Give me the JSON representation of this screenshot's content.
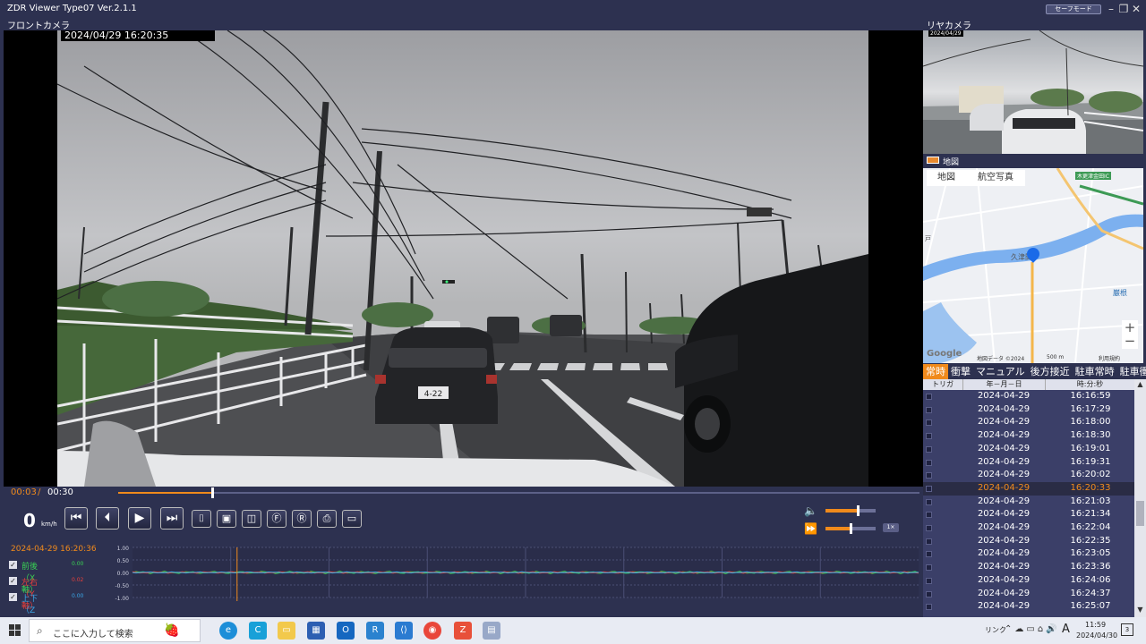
{
  "window": {
    "title": "ZDR Viewer Type07 Ver.2.1.1",
    "safe_mode_label": "セーフモード"
  },
  "front_camera": {
    "label": "フロントカメラ",
    "timestamp": "2024/04/29   16:20:35",
    "plate_text": "4-22"
  },
  "rear_camera": {
    "label": "リヤカメラ",
    "timestamp": "2024/04/29"
  },
  "map": {
    "title": "地図",
    "tabs": [
      "地図",
      "航空写真"
    ],
    "labels": {
      "area": "久津間",
      "ic": "木更津金田IC",
      "left": "戸",
      "right": "巌根",
      "google": "Google"
    },
    "credit": "地図データ ©2024",
    "scale": "500 m",
    "terms": "利用規約",
    "zoom_in": "+",
    "zoom_out": "−"
  },
  "record_tabs": [
    {
      "label": "常時",
      "active": true
    },
    {
      "label": "衝撃",
      "active": false
    },
    {
      "label": "マニュアル",
      "active": false
    },
    {
      "label": "後方接近",
      "active": false
    },
    {
      "label": "駐車常時",
      "active": false
    },
    {
      "label": "駐車衝撃",
      "active": false
    }
  ],
  "record_list": {
    "headers": {
      "trigger": "トリガ",
      "date": "年－月－日",
      "time": "時:分:秒"
    },
    "selected_index": 7,
    "rows": [
      {
        "date": "2024-04-29",
        "time": "16:16:59"
      },
      {
        "date": "2024-04-29",
        "time": "16:17:29"
      },
      {
        "date": "2024-04-29",
        "time": "16:18:00"
      },
      {
        "date": "2024-04-29",
        "time": "16:18:30"
      },
      {
        "date": "2024-04-29",
        "time": "16:19:01"
      },
      {
        "date": "2024-04-29",
        "time": "16:19:31"
      },
      {
        "date": "2024-04-29",
        "time": "16:20:02"
      },
      {
        "date": "2024-04-29",
        "time": "16:20:33"
      },
      {
        "date": "2024-04-29",
        "time": "16:21:03"
      },
      {
        "date": "2024-04-29",
        "time": "16:21:34"
      },
      {
        "date": "2024-04-29",
        "time": "16:22:04"
      },
      {
        "date": "2024-04-29",
        "time": "16:22:35"
      },
      {
        "date": "2024-04-29",
        "time": "16:23:05"
      },
      {
        "date": "2024-04-29",
        "time": "16:23:36"
      },
      {
        "date": "2024-04-29",
        "time": "16:24:06"
      },
      {
        "date": "2024-04-29",
        "time": "16:24:37"
      },
      {
        "date": "2024-04-29",
        "time": "16:25:07"
      }
    ]
  },
  "playback": {
    "current": "00:03",
    "separator": "/",
    "total": "00:30",
    "progress": 0.117
  },
  "controls": {
    "speed_value": "0",
    "speed_unit": "km/h",
    "volume_level": 0.64,
    "playback_speed_level": 0.5,
    "playback_speed_badge": "1×"
  },
  "gsensor": {
    "timestamp": "2024-04-29 16:20:36",
    "axes": [
      {
        "name": "前後（X軸）",
        "value": "0.00",
        "color": "#39d353"
      },
      {
        "name": "左右（Y軸）",
        "value": "0.02",
        "color": "#e8403b"
      },
      {
        "name": "上下（Z軸）",
        "value": "0.00",
        "color": "#3aa8e8"
      }
    ],
    "yticks": [
      "1.00",
      "0.50",
      "0.00",
      "-0.50",
      "-1.00"
    ],
    "cursor": 0.133
  },
  "taskbar": {
    "search_placeholder": "ここに入力して検索",
    "tray_text": "リンク",
    "ime": "A",
    "time": "11:59",
    "date": "2024/04/30",
    "notification_count": "3"
  }
}
